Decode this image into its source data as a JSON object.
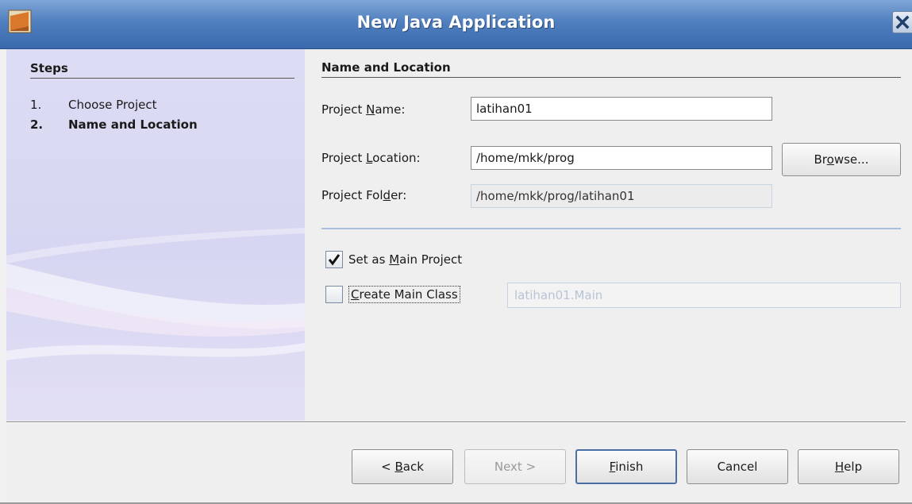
{
  "window": {
    "title": "New Java Application"
  },
  "steps": {
    "title": "Steps",
    "items": [
      {
        "num": "1.",
        "label": "Choose Project"
      },
      {
        "num": "2.",
        "label": "Name and Location"
      }
    ]
  },
  "content": {
    "title": "Name and Location",
    "project_name": {
      "label_pre": "Project ",
      "label_mnemonic": "N",
      "label_post": "ame:",
      "value": "latihan01"
    },
    "project_location": {
      "label_pre": "Project ",
      "label_mnemonic": "L",
      "label_post": "ocation:",
      "value": "/home/mkk/prog"
    },
    "project_folder": {
      "label_pre": "Project Fol",
      "label_mnemonic": "d",
      "label_post": "er:",
      "value": "/home/mkk/prog/latihan01"
    },
    "browse": {
      "pre": "Br",
      "mnemonic": "o",
      "post": "wse..."
    },
    "set_main": {
      "pre": "Set as ",
      "mnemonic": "M",
      "post": "ain Project",
      "checked": true
    },
    "create_main": {
      "pre": "",
      "mnemonic": "C",
      "post": "reate Main Class",
      "checked": false,
      "value": "latihan01.Main"
    }
  },
  "buttons": {
    "back": {
      "pre": "< ",
      "mnemonic": "B",
      "post": "ack"
    },
    "next": {
      "label": "Next >"
    },
    "finish": {
      "pre": "",
      "mnemonic": "F",
      "post": "inish"
    },
    "cancel": {
      "label": "Cancel"
    },
    "help": {
      "pre": "",
      "mnemonic": "H",
      "post": "elp"
    }
  },
  "colors": {
    "titlebar": "#4f7fbe",
    "steps_panel": "#d6d6f2",
    "separator": "#a9bfdc"
  }
}
